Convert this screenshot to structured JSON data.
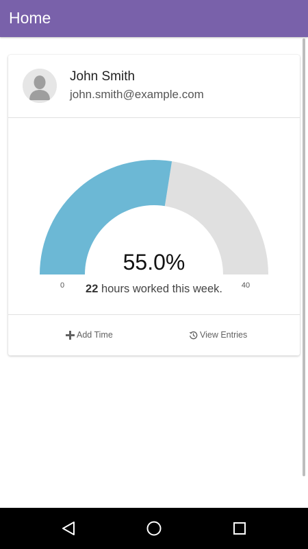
{
  "app_bar": {
    "title": "Home",
    "color": "#7961aa"
  },
  "profile": {
    "avatar_icon": "user-avatar-icon",
    "name": "John Smith",
    "email": "john.smith@example.com"
  },
  "gauge": {
    "percent_label": "55.0%",
    "fraction": 0.55,
    "min": 0,
    "max": 40,
    "min_label": "0",
    "max_label": "40",
    "fill_color": "#6cb8d5",
    "track_color": "#e0e0e0"
  },
  "summary": {
    "hours": "22",
    "text": " hours worked this week."
  },
  "actions": {
    "add_time": {
      "icon": "plus-icon",
      "label": "Add Time"
    },
    "view_entries": {
      "icon": "history-icon",
      "label": "View Entries"
    }
  },
  "nav_bar": {
    "back_icon": "back-triangle-icon",
    "home_icon": "home-circle-icon",
    "recents_icon": "recents-square-icon"
  }
}
